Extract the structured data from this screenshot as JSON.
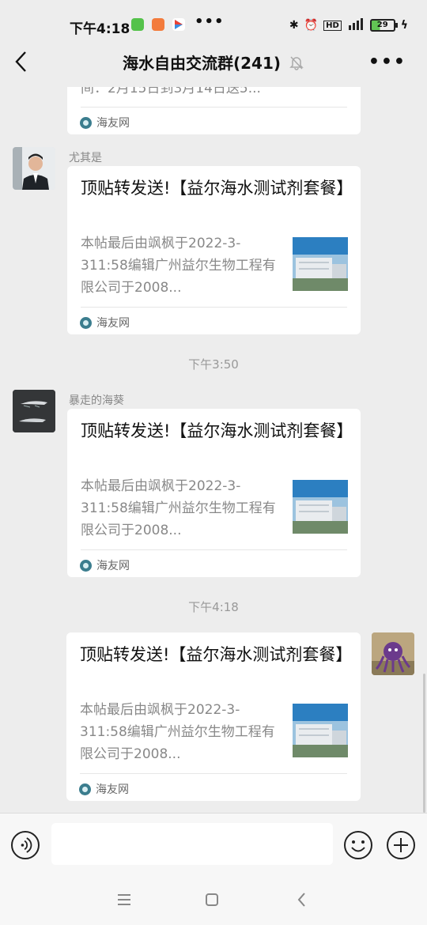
{
  "status_bar": {
    "time": "下午4:18",
    "dots": "•••",
    "battery": "29"
  },
  "header": {
    "title": "海水自由交流群(241)",
    "more_label": "•••"
  },
  "top_partial_card": {
    "desc": "间：2月15日到3月14日送5...",
    "source": "海友网"
  },
  "messages": [
    {
      "sender": "尤其是",
      "title": "顶贴转发送!【益尔海水测试剂套餐】",
      "desc": "本帖最后由飒枫于2022-3-311:58编辑广州益尔生物工程有限公司于2008...",
      "thumb_text": "公司地址\n留学人员创业园",
      "source": "海友网"
    },
    {
      "sender": "暴走的海葵",
      "title": "顶贴转发送!【益尔海水测试剂套餐】",
      "desc": "本帖最后由飒枫于2022-3-311:58编辑广州益尔生物工程有限公司于2008...",
      "thumb_text": "公司地址\n留学人员创业园",
      "source": "海友网"
    },
    {
      "sender": "",
      "title": "顶贴转发送!【益尔海水测试剂套餐】",
      "desc": "本帖最后由飒枫于2022-3-311:58编辑广州益尔生物工程有限公司于2008...",
      "thumb_text": "公司地址\n留学人员创业园",
      "source": "海友网"
    }
  ],
  "time_separators": [
    "下午3:50",
    "下午4:18"
  ],
  "input": {
    "value": "",
    "placeholder": ""
  },
  "colors": {
    "background": "#ededed",
    "card": "#ffffff",
    "accent": "#07c160"
  }
}
